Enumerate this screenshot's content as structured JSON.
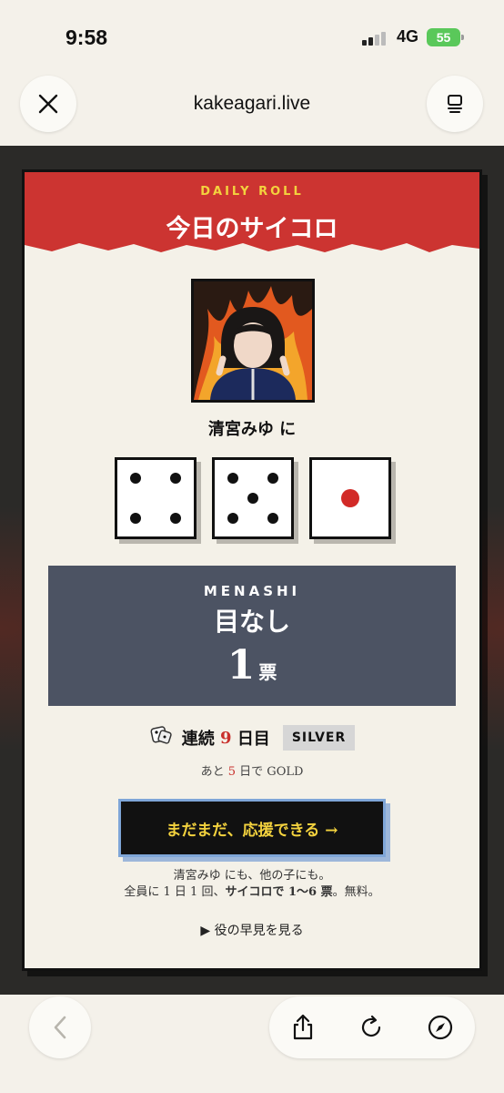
{
  "status": {
    "time": "9:58",
    "network": "4G",
    "battery": "55"
  },
  "browser": {
    "url": "kakeagari.live"
  },
  "banner": {
    "subtitle": "DAILY ROLL",
    "title": "今日のサイコロ"
  },
  "member": {
    "to_label": "清宮みゆ に"
  },
  "dice": [
    4,
    5,
    1
  ],
  "result": {
    "roman": "MENASHI",
    "name": "目なし",
    "votes": "1",
    "votes_unit": "票"
  },
  "streak": {
    "prefix": "連続",
    "days": "9",
    "suffix": "日目",
    "rank": "SILVER"
  },
  "next_rank": {
    "prefix": "あと",
    "days": "5",
    "suffix": "日で GOLD"
  },
  "cta": {
    "label": "まだまだ、応援できる →"
  },
  "note": {
    "line1": "清宮みゆ にも、他の子にも。",
    "line2_a": "全員に 1 日 1 回、",
    "line2_b": "サイコロで 1〜6 票",
    "line2_c": "。無料。"
  },
  "peek": {
    "label": "▶ 役の早見を見る"
  },
  "icons": [
    "close-icon",
    "tabs-icon",
    "back-arrow-icon",
    "share-icon",
    "reload-icon",
    "compass-icon",
    "dice-icon"
  ]
}
